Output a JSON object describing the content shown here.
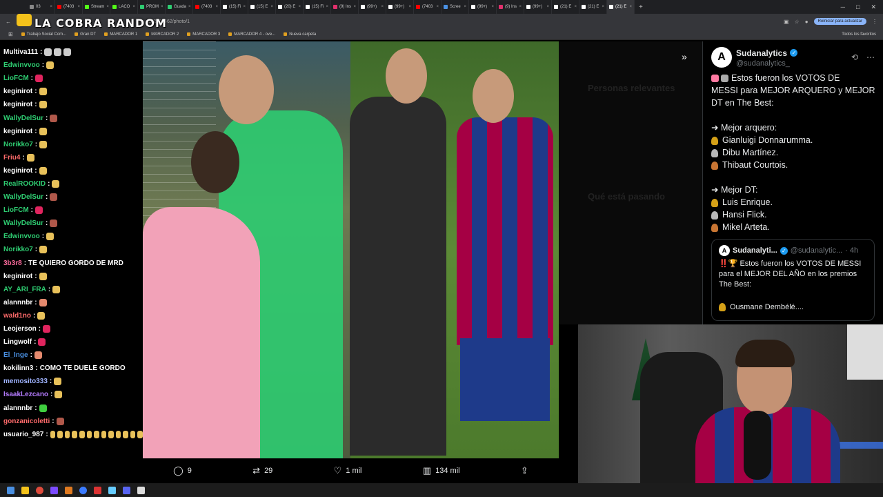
{
  "overlay": {
    "title": "LA COBRA RANDOM"
  },
  "browser": {
    "tabs": [
      {
        "label": "03",
        "color": "#888"
      },
      {
        "label": "(7403",
        "color": "#ff0000"
      },
      {
        "label": "Stream",
        "color": "#53fc18"
      },
      {
        "label": "LACO",
        "color": "#53fc18"
      },
      {
        "label": "PROM",
        "color": "#2ecc71"
      },
      {
        "label": "Guada",
        "color": "#2ecc71"
      },
      {
        "label": "(7403",
        "color": "#ff0000"
      },
      {
        "label": "(15) Fi",
        "color": "#ffffff"
      },
      {
        "label": "(15) E",
        "color": "#ffffff"
      },
      {
        "label": "(20) E",
        "color": "#ffffff"
      },
      {
        "label": "(15) Fi",
        "color": "#ffffff"
      },
      {
        "label": "(9) Ins",
        "color": "#e1306c"
      },
      {
        "label": "(99+)",
        "color": "#ffffff"
      },
      {
        "label": "(99+)",
        "color": "#ffffff"
      },
      {
        "label": "(7403",
        "color": "#ff0000"
      },
      {
        "label": "Scree",
        "color": "#4a90e2"
      },
      {
        "label": "(99+)",
        "color": "#ffffff"
      },
      {
        "label": "(9) Ins",
        "color": "#e1306c"
      },
      {
        "label": "(99+)",
        "color": "#ffffff"
      },
      {
        "label": "(21) E",
        "color": "#ffffff"
      },
      {
        "label": "(21) E",
        "color": "#ffffff"
      },
      {
        "label": "(21) E",
        "color": "#ffffff"
      }
    ],
    "new_tab": "+",
    "url": "262207462/photo/1",
    "reload_button": "Reiniciar para actualizar",
    "bookmarks": [
      "Trabajo Social Com...",
      "Gran DT",
      "MARCADOR 1",
      "MARCADOR 2",
      "MARCADOR 3",
      "MARCADOR 4 - ove...",
      "Nueva carpeta"
    ],
    "all_bookmarks": "Todos los favoritos"
  },
  "chat": [
    {
      "user": "Multiva111",
      "color": "#ffffff",
      "text": "",
      "emotes": [
        "#cccccc",
        "#cccccc",
        "#cccccc"
      ]
    },
    {
      "user": "Edwinvvoo",
      "color": "#2ecc71",
      "text": "",
      "emotes": [
        "#e8c15a"
      ]
    },
    {
      "user": "LioFCM",
      "color": "#2ecc71",
      "text": "",
      "emotes": [
        "#e0245e"
      ]
    },
    {
      "user": "keginirot",
      "color": "#ffffff",
      "text": "",
      "emotes": [
        "#e8c15a"
      ]
    },
    {
      "user": "keginirot",
      "color": "#ffffff",
      "text": "",
      "emotes": [
        "#e8c15a"
      ]
    },
    {
      "user": "WallyDelSur",
      "color": "#2ecc71",
      "text": "",
      "emotes": [
        "#b0584a"
      ]
    },
    {
      "user": "keginirot",
      "color": "#ffffff",
      "text": "",
      "emotes": [
        "#e8c15a"
      ]
    },
    {
      "user": "Norikko7",
      "color": "#2ecc71",
      "text": "",
      "emotes": [
        "#e8c15a"
      ]
    },
    {
      "user": "Friu4",
      "color": "#ff6b6b",
      "text": "",
      "emotes": [
        "#e8c15a"
      ]
    },
    {
      "user": "keginirot",
      "color": "#ffffff",
      "text": "",
      "emotes": [
        "#e8c15a"
      ]
    },
    {
      "user": "RealROOKID",
      "color": "#2ecc71",
      "text": "",
      "emotes": [
        "#e8c15a"
      ]
    },
    {
      "user": "WallyDelSur",
      "color": "#2ecc71",
      "text": "",
      "emotes": [
        "#b0584a"
      ]
    },
    {
      "user": "LioFCM",
      "color": "#2ecc71",
      "text": "",
      "emotes": [
        "#e0245e"
      ]
    },
    {
      "user": "WallyDelSur",
      "color": "#2ecc71",
      "text": "",
      "emotes": [
        "#b0584a"
      ]
    },
    {
      "user": "Edwinvvoo",
      "color": "#2ecc71",
      "text": "",
      "emotes": [
        "#e8c15a"
      ]
    },
    {
      "user": "Norikko7",
      "color": "#2ecc71",
      "text": "",
      "emotes": [
        "#e8c15a"
      ]
    },
    {
      "user": "3b3r8",
      "color": "#ff6b9d",
      "text": "TE QUIERO GORDO DE MRD",
      "emotes": []
    },
    {
      "user": "keginirot",
      "color": "#ffffff",
      "text": "",
      "emotes": [
        "#e8c15a"
      ]
    },
    {
      "user": "AY_ARI_FRA",
      "color": "#2ecc71",
      "text": "",
      "emotes": [
        "#e8c15a"
      ]
    },
    {
      "user": "alannnbr",
      "color": "#ffffff",
      "text": "",
      "emotes": [
        "#e58a6e"
      ]
    },
    {
      "user": "wald1no",
      "color": "#ff6b6b",
      "text": "",
      "emotes": [
        "#e8c15a"
      ]
    },
    {
      "user": "Leojerson",
      "color": "#ffffff",
      "text": "",
      "emotes": [
        "#e0245e"
      ]
    },
    {
      "user": "Lingwolf",
      "color": "#ffffff",
      "text": "",
      "emotes": [
        "#e0245e"
      ]
    },
    {
      "user": "El_Inge",
      "color": "#4a90e2",
      "text": "",
      "emotes": [
        "#e58a6e"
      ]
    },
    {
      "user": "kokilinn3",
      "color": "#ffffff",
      "text": "COMO TE DUELE GORDO",
      "emotes": []
    },
    {
      "user": "memosito333",
      "color": "#9fb3ff",
      "text": "",
      "emotes": [
        "#e8c15a"
      ]
    },
    {
      "user": "IsaakLezcano",
      "color": "#b57cff",
      "text": "",
      "emotes": [
        "#e8c15a"
      ]
    },
    {
      "user": "alannnbr",
      "color": "#ffffff",
      "text": "",
      "emotes": [
        "#3fce3f"
      ]
    },
    {
      "user": "gonzanicoletti",
      "color": "#ff6b6b",
      "text": "",
      "emotes": [
        "#b0584a"
      ]
    },
    {
      "user": "usuario_987",
      "color": "#ffffff",
      "text": "",
      "emotes": [
        "#e8c15a",
        "#e8c15a",
        "#e8c15a",
        "#e8c15a",
        "#e8c15a",
        "#e8c15a",
        "#e8c15a",
        "#e8c15a",
        "#e8c15a",
        "#e8c15a",
        "#e8c15a",
        "#e8c15a",
        "#e8c15a"
      ]
    }
  ],
  "tweet": {
    "name": "Sudanalytics",
    "handle": "@sudanalytics_",
    "lines": [
      "Estos fueron los VOTOS DE",
      "MESSI para MEJOR ARQUERO y MEJOR",
      "DT en The Best:",
      "",
      "➜ Mejor arquero:",
      "Gianluigi Donnarumma.",
      "Dibu Martínez.",
      "Thibaut Courtois.",
      "",
      "➜ Mejor DT:",
      "Luis Enrique.",
      "Hansi Flick.",
      "Mikel Arteta."
    ],
    "quote": {
      "name": "Sudanalyti...",
      "handle": "@sudanalytic...",
      "time": "· 4h",
      "lines": [
        "‼️🏆 Estos fueron los VOTOS DE MESSI para el MEJOR DEL AÑO en los premios The Best:",
        "",
        "Ousmane Dembélé...."
      ]
    },
    "footer": {
      "replies": "9",
      "retweets": "29",
      "likes": "1 mil",
      "views": "134 mil"
    }
  },
  "sidebar_ghost": [
    "Personas relevantes",
    "Qué está pasando"
  ]
}
